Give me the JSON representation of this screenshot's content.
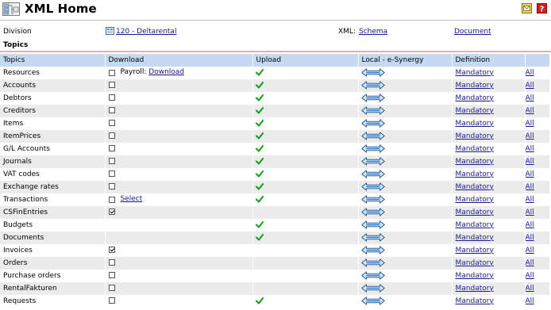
{
  "header": {
    "title": "XML Home",
    "app_icon": "xml-sitemap-icon",
    "buttons": [
      {
        "name": "message-button",
        "icon": "envelope-icon"
      },
      {
        "name": "help-button",
        "icon": "question-icon"
      }
    ]
  },
  "division": {
    "label": "Division",
    "value": "120 - Deltarental",
    "xml_label": "XML:",
    "schema_link": "Schema",
    "document_link": "Document"
  },
  "section_title": "Topics",
  "columns": [
    "Topics",
    "Download",
    "Upload",
    "Local - e-Synergy",
    "Definition"
  ],
  "definition_label": "Mandatory",
  "all_label": "All",
  "rows": [
    {
      "topic": "Resources",
      "download": "unchecked",
      "download_extra_label": "Payroll:",
      "download_extra_link": "Download",
      "upload": true
    },
    {
      "topic": "Accounts",
      "download": "unchecked",
      "upload": true
    },
    {
      "topic": "Debtors",
      "download": "unchecked",
      "upload": true
    },
    {
      "topic": "Creditors",
      "download": "unchecked",
      "upload": true
    },
    {
      "topic": "Items",
      "download": "unchecked",
      "upload": true
    },
    {
      "topic": "ItemPrices",
      "download": "unchecked",
      "upload": true
    },
    {
      "topic": "G/L Accounts",
      "download": "unchecked",
      "upload": true
    },
    {
      "topic": "Journals",
      "download": "unchecked",
      "upload": true
    },
    {
      "topic": "VAT codes",
      "download": "unchecked",
      "upload": true
    },
    {
      "topic": "Exchange rates",
      "download": "unchecked",
      "upload": true
    },
    {
      "topic": "Transactions",
      "download": "unchecked",
      "download_extra_link": "Select",
      "upload": true
    },
    {
      "topic": "CSFinEntries",
      "download": "checked",
      "upload": false
    },
    {
      "topic": "Budgets",
      "download": "none",
      "upload": true
    },
    {
      "topic": "Documents",
      "download": "none",
      "upload": true
    },
    {
      "topic": "Invoices",
      "download": "checked",
      "upload": false
    },
    {
      "topic": "Orders",
      "download": "unchecked",
      "upload": false
    },
    {
      "topic": "Purchase orders",
      "download": "unchecked",
      "upload": false
    },
    {
      "topic": "RentalFakturen",
      "download": "unchecked",
      "upload": false
    },
    {
      "topic": "Requests",
      "download": "unchecked",
      "upload": true
    }
  ],
  "colors": {
    "header_row": "#c5d9f1",
    "alt_row": "#ebebeb",
    "link": "#1a1a8c",
    "check_green": "#22a022",
    "arrow_blue": "#2f7fd8"
  }
}
